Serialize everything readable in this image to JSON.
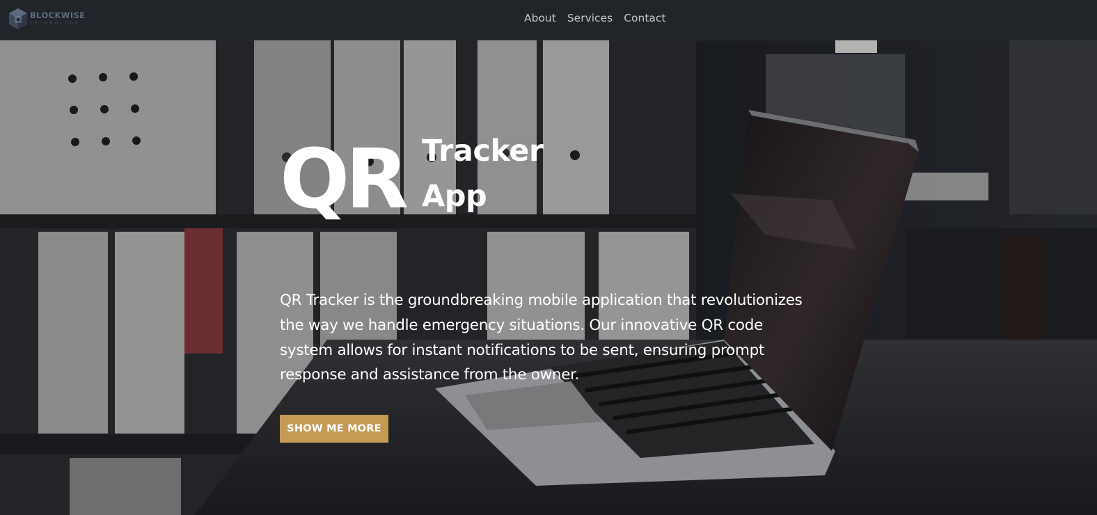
{
  "brand": {
    "name": "BLOCKWISE",
    "tagline": "TECHNOLOGY",
    "icon": "cube-logo-icon"
  },
  "nav": {
    "items": [
      {
        "label": "About"
      },
      {
        "label": "Services"
      },
      {
        "label": "Contact"
      }
    ]
  },
  "hero": {
    "title_big": "QR",
    "title_line1": "Tracker",
    "title_line2": "App",
    "description": "QR Tracker is the groundbreaking mobile application that revolutionizes the way we handle emergency situations. Our innovative QR code system allows for instant notifications to be sent, ensuring prompt response and assistance from the owner.",
    "cta_label": "SHOW ME MORE",
    "background": "laptop-on-desk-office-photo"
  },
  "colors": {
    "navbar_bg": "#212429",
    "accent": "#c49a54",
    "nav_text": "#c4c6c9",
    "hero_text": "#ffffff"
  }
}
